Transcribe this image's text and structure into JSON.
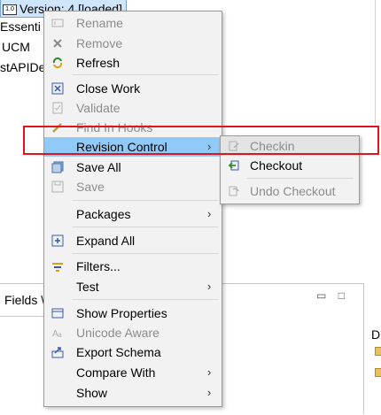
{
  "tree": {
    "version_label": "Version: 4 [loaded]",
    "items": [
      "Essenti",
      "UCM",
      "stAPIDe"
    ]
  },
  "bottom": {
    "fields_tab": "Fields \\",
    "minimize": "▭",
    "maximize": "□",
    "right_letter": "D"
  },
  "menu": {
    "items": [
      {
        "label": "Rename",
        "enabled": false,
        "icon": "rename-icon"
      },
      {
        "label": "Remove",
        "enabled": false,
        "icon": "remove-icon"
      },
      {
        "label": "Refresh",
        "enabled": true,
        "icon": "refresh-icon"
      },
      {
        "label": "Close Work",
        "enabled": true,
        "icon": "close-work-icon"
      },
      {
        "label": "Validate",
        "enabled": false,
        "icon": "validate-icon"
      },
      {
        "label": "Find In Hooks",
        "enabled": false,
        "icon": "find-hooks-icon"
      },
      {
        "label": "Revision Control",
        "enabled": true,
        "highlighted": true,
        "submenu": true
      },
      {
        "label": "Save All",
        "enabled": true,
        "icon": "save-all-icon"
      },
      {
        "label": "Save",
        "enabled": false,
        "icon": "save-icon"
      },
      {
        "label": "Packages",
        "enabled": true,
        "submenu": true
      },
      {
        "label": "Expand All",
        "enabled": true,
        "icon": "expand-all-icon"
      },
      {
        "label": "Filters...",
        "enabled": true,
        "icon": "filter-icon"
      },
      {
        "label": "Test",
        "enabled": true,
        "submenu": true
      },
      {
        "label": "Show Properties",
        "enabled": true,
        "icon": "properties-icon"
      },
      {
        "label": "Unicode Aware",
        "enabled": false,
        "icon": "unicode-icon"
      },
      {
        "label": "Export Schema",
        "enabled": true,
        "icon": "export-icon"
      },
      {
        "label": "Compare With",
        "enabled": true,
        "submenu": true
      },
      {
        "label": "Show",
        "enabled": true,
        "submenu": true
      }
    ]
  },
  "submenu": {
    "items": [
      {
        "label": "Checkin",
        "enabled": false,
        "icon": "checkin-icon"
      },
      {
        "label": "Checkout",
        "enabled": true,
        "icon": "checkout-icon"
      },
      {
        "label": "Undo Checkout",
        "enabled": false,
        "icon": "undo-checkout-icon"
      }
    ]
  },
  "colors": {
    "highlight": "#91c9f7",
    "annotation": "#e0141e"
  }
}
